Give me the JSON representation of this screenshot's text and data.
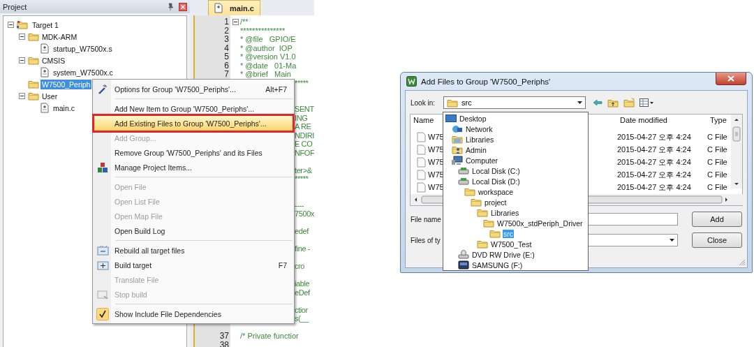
{
  "project_panel": {
    "title": "Project",
    "tree": [
      {
        "label": "Target 1",
        "kind": "target",
        "expanded": true,
        "selected": false,
        "children": [
          {
            "label": "MDK-ARM",
            "kind": "group",
            "expanded": true,
            "selected": false,
            "children": [
              {
                "label": "startup_W7500x.s",
                "kind": "file",
                "selected": false
              }
            ]
          },
          {
            "label": "CMSIS",
            "kind": "group",
            "expanded": true,
            "selected": false,
            "children": [
              {
                "label": "system_W7500x.c",
                "kind": "file",
                "selected": false
              }
            ]
          },
          {
            "label": "W7500_Periph",
            "kind": "group",
            "selected": true
          },
          {
            "label": "User",
            "kind": "group",
            "expanded": true,
            "selected": false,
            "children": [
              {
                "label": "main.c",
                "kind": "file",
                "selected": false
              }
            ]
          }
        ]
      }
    ]
  },
  "editor": {
    "tab": {
      "label": "main.c",
      "selected": true
    },
    "lines": [
      {
        "kind": "fold",
        "number": "1",
        "text": "/**"
      },
      {
        "kind": "full",
        "number": "2",
        "text": "***************"
      },
      {
        "kind": "full",
        "number": "3",
        "text": "* @file   GPIO/E"
      },
      {
        "kind": "full",
        "number": "4",
        "text": "* @author  IOP"
      },
      {
        "kind": "full",
        "number": "5",
        "text": "* @version V1.0"
      },
      {
        "kind": "full",
        "number": "6",
        "text": "* @date   01-Ma"
      },
      {
        "kind": "full",
        "number": "7",
        "text": "* @brief   Main"
      },
      {
        "kind": "tail",
        "text": "*****"
      },
      {
        "kind": "blank"
      },
      {
        "kind": "blank"
      },
      {
        "kind": "tail",
        "text": "SENT"
      },
      {
        "kind": "tail",
        "text": "ING"
      },
      {
        "kind": "tail",
        "text": "A RE"
      },
      {
        "kind": "tail",
        "text": "NDIRI"
      },
      {
        "kind": "tail",
        "text": "E CO"
      },
      {
        "kind": "tail",
        "text": "NFOF"
      },
      {
        "kind": "blank"
      },
      {
        "kind": "tail",
        "text": "ter>&"
      },
      {
        "kind": "tail",
        "text": "*****"
      },
      {
        "kind": "blank"
      },
      {
        "kind": "blank"
      },
      {
        "kind": "tail",
        "text": "----"
      },
      {
        "kind": "tail",
        "text": "7500x"
      },
      {
        "kind": "blank"
      },
      {
        "kind": "tail",
        "text": "edef"
      },
      {
        "kind": "blank"
      },
      {
        "kind": "tail",
        "text": "fine -"
      },
      {
        "kind": "blank"
      },
      {
        "kind": "tail",
        "text": "cro"
      },
      {
        "kind": "blank"
      },
      {
        "kind": "tail",
        "text": "iable"
      },
      {
        "kind": "tail",
        "text": "eDef"
      },
      {
        "kind": "blank"
      },
      {
        "kind": "tail",
        "text": "ctior"
      },
      {
        "kind": "tail",
        "text": "s(__"
      },
      {
        "kind": "blank"
      },
      {
        "kind": "full",
        "number": "37",
        "text": "/* Private functior"
      },
      {
        "kind": "full",
        "number": "38"
      }
    ]
  },
  "context_menu": {
    "items": [
      {
        "kind": "wand",
        "label": "Options for Group 'W7500_Periphs'...",
        "shortcut": "Alt+F7",
        "selected": false,
        "disabled": false,
        "checked": false
      },
      {
        "kind": "separator"
      },
      {
        "kind": "plain",
        "label": "Add New Item to Group 'W7500_Periphs'...",
        "selected": false,
        "disabled": false,
        "checked": false
      },
      {
        "kind": "plain",
        "label": "Add Existing Files to Group 'W7500_Periphs'...",
        "selected": true,
        "disabled": false,
        "checked": false
      },
      {
        "kind": "plain",
        "label": "Add Group...",
        "selected": false,
        "disabled": true,
        "checked": false
      },
      {
        "kind": "plain",
        "label": "Remove Group 'W7500_Periphs' and its Files",
        "selected": false,
        "disabled": false,
        "checked": false
      },
      {
        "kind": "blocks",
        "label": "Manage Project Items...",
        "selected": false,
        "disabled": false,
        "checked": false
      },
      {
        "kind": "separator"
      },
      {
        "kind": "plain",
        "label": "Open File",
        "selected": false,
        "disabled": true,
        "checked": false
      },
      {
        "kind": "plain",
        "label": "Open List File",
        "selected": false,
        "disabled": true,
        "checked": false
      },
      {
        "kind": "plain",
        "label": "Open Map File",
        "selected": false,
        "disabled": true,
        "checked": false
      },
      {
        "kind": "plain",
        "label": "Open Build Log",
        "selected": false,
        "disabled": false,
        "checked": false
      },
      {
        "kind": "separator"
      },
      {
        "kind": "rebuild",
        "label": "Rebuild all target files",
        "selected": false,
        "disabled": false,
        "checked": false
      },
      {
        "kind": "build",
        "label": "Build target",
        "shortcut": "F7",
        "selected": false,
        "disabled": false,
        "checked": false
      },
      {
        "kind": "plain",
        "label": "Translate File",
        "selected": false,
        "disabled": true,
        "checked": false
      },
      {
        "kind": "stop",
        "label": "Stop build",
        "selected": false,
        "disabled": true,
        "checked": false
      },
      {
        "kind": "separator"
      },
      {
        "kind": "plain",
        "label": "Show Include File Dependencies",
        "selected": false,
        "disabled": false,
        "checked": true
      }
    ]
  },
  "dialog": {
    "title": "Add Files to Group 'W7500_Periphs'",
    "look_in": {
      "label": "Look in:",
      "value": "src"
    },
    "columns": [
      {
        "label": "Name"
      },
      {
        "label": "Date modified"
      },
      {
        "label": "Type"
      }
    ],
    "rows": [
      {
        "name": "W75",
        "date": "2015-04-27 오후 4:24",
        "type": "C File"
      },
      {
        "name": "W75",
        "date": "2015-04-27 오후 4:24",
        "type": "C File"
      },
      {
        "name": "W75",
        "date": "2015-04-27 오후 4:24",
        "type": "C File"
      },
      {
        "name": "W75",
        "date": "2015-04-27 오후 4:24",
        "type": "C File"
      },
      {
        "name": "W75",
        "date": "2015-04-27 오후 4:24",
        "type": "C File"
      }
    ],
    "file_name": {
      "label": "File name"
    },
    "file_type": {
      "label": "Files of ty"
    },
    "buttons": [
      "Add",
      "Close"
    ],
    "locations": [
      {
        "label": "Desktop",
        "kind": "desktop",
        "selected": false,
        "children": [
          {
            "label": "Network",
            "kind": "network",
            "selected": false
          },
          {
            "label": "Libraries",
            "kind": "libraries",
            "selected": false
          },
          {
            "label": "Admin",
            "kind": "user",
            "selected": false
          },
          {
            "label": "Computer",
            "kind": "computer",
            "selected": false,
            "children": [
              {
                "label": "Local Disk (C:)",
                "kind": "disk",
                "selected": false
              },
              {
                "label": "Local Disk (D:)",
                "kind": "disk",
                "selected": false,
                "children": [
                  {
                    "label": "workspace",
                    "kind": "folder",
                    "selected": false,
                    "children": [
                      {
                        "label": "project",
                        "kind": "folder",
                        "selected": false,
                        "children": [
                          {
                            "label": "Libraries",
                            "kind": "folder",
                            "selected": false,
                            "children": [
                              {
                                "label": "W7500x_stdPeriph_Driver",
                                "kind": "folder",
                                "selected": false,
                                "children": [
                                  {
                                    "label": "src",
                                    "kind": "folder",
                                    "selected": true
                                  }
                                ]
                              }
                            ]
                          },
                          {
                            "label": "W7500_Test",
                            "kind": "folder",
                            "selected": false
                          }
                        ]
                      }
                    ]
                  }
                ]
              },
              {
                "label": "DVD RW Drive (E:)",
                "kind": "dvd",
                "selected": false
              },
              {
                "label": "SAMSUNG (F:)",
                "kind": "usb",
                "selected": false
              }
            ]
          }
        ]
      }
    ]
  }
}
